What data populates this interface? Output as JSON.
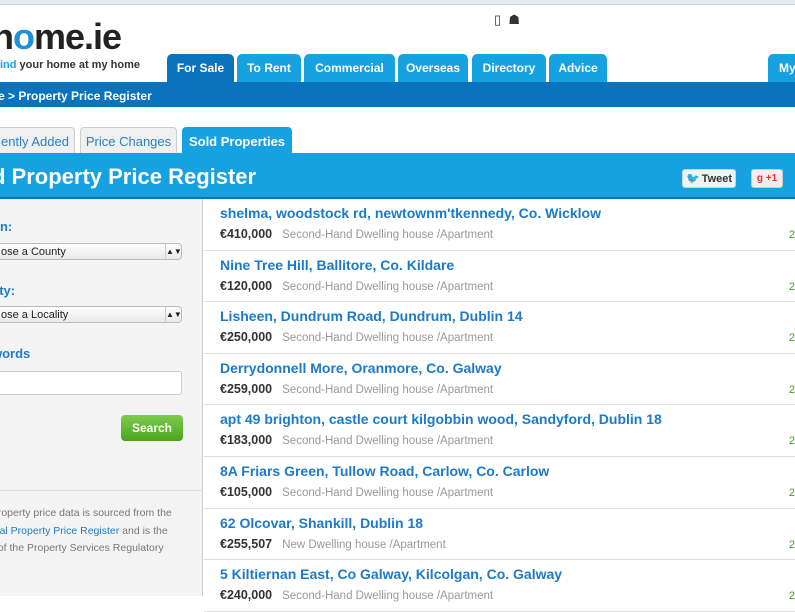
{
  "header": {
    "logo": "home.ie",
    "tagline_accent": "ind",
    "tagline_rest": " your home at my home",
    "device_icons": [
      "mobile-phone-icon",
      "android-icon"
    ]
  },
  "nav": {
    "tabs": [
      {
        "label": "For Sale",
        "active": true
      },
      {
        "label": "To Rent"
      },
      {
        "label": "Commercial"
      },
      {
        "label": "Overseas"
      },
      {
        "label": "Directory"
      },
      {
        "label": "Advice"
      },
      {
        "label": "My"
      }
    ]
  },
  "breadcrumb": "e > Property Price Register",
  "subtabs": [
    {
      "label": "ently Added"
    },
    {
      "label": "Price Changes"
    },
    {
      "label": "Sold Properties",
      "active": true
    }
  ],
  "banner": {
    "title": "d Property Price Register",
    "tweet": "Tweet",
    "gplus": "+1"
  },
  "sidebar": {
    "location_label": "on:",
    "county_value": "ose a County",
    "locality_label": "lity:",
    "locality_value": "ose a Locality",
    "keywords_label": "words",
    "keywords_value": "",
    "search_button": "Search",
    "note_1": " property price data is sourced from the",
    "note_link": "cial Property Price Register",
    "note_2": " and is the",
    "note_3a": "t",
    "note_3b": " of the Property Services Regulatory"
  },
  "listings": [
    {
      "address": "shelma, woodstock rd, newtownm'tkennedy, Co. Wicklow",
      "price": "€410,000",
      "type": "Second-Hand Dwelling house /Apartment",
      "date": "2"
    },
    {
      "address": "Nine Tree Hill, Ballitore, Co. Kildare",
      "price": "€120,000",
      "type": "Second-Hand Dwelling house /Apartment",
      "date": "2"
    },
    {
      "address": "Lisheen, Dundrum Road, Dundrum, Dublin 14",
      "price": "€250,000",
      "type": "Second-Hand Dwelling house /Apartment",
      "date": "2"
    },
    {
      "address": "Derrydonnell More, Oranmore, Co. Galway",
      "price": "€259,000",
      "type": "Second-Hand Dwelling house /Apartment",
      "date": "2"
    },
    {
      "address": "apt 49 brighton, castle court kilgobbin wood, Sandyford, Dublin 18",
      "price": "€183,000",
      "type": "Second-Hand Dwelling house /Apartment",
      "date": "2"
    },
    {
      "address": "8A Friars Green, Tullow Road, Carlow, Co. Carlow",
      "price": "€105,000",
      "type": "Second-Hand Dwelling house /Apartment",
      "date": "2"
    },
    {
      "address": "62 Olcovar, Shankill, Dublin 18",
      "price": "€255,507",
      "type": "New Dwelling house /Apartment",
      "date": "2"
    },
    {
      "address": "5 Kiltiernan East, Co Galway, Kilcolgan, Co. Galway",
      "price": "€240,000",
      "type": "Second-Hand Dwelling house /Apartment",
      "date": "2"
    }
  ],
  "colors": {
    "accent": "#16a1e0",
    "dark_blue": "#0a73bd",
    "link": "#1d7ac6",
    "search_green": "#5bb52f",
    "date_green": "#3aa21e"
  }
}
